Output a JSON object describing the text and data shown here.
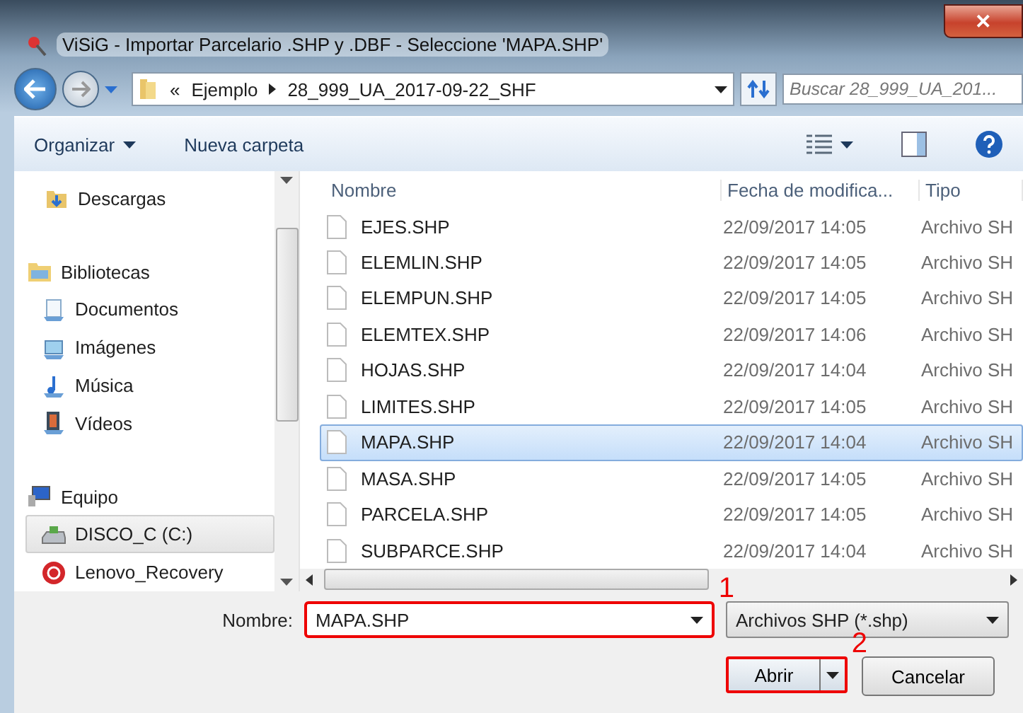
{
  "window": {
    "title": "ViSiG - Importar Parcelario .SHP y .DBF - Seleccione 'MAPA.SHP'",
    "close": "✕"
  },
  "address": {
    "overflow": "«",
    "crumbs": [
      "Ejemplo",
      "28_999_UA_2017-09-22_SHF"
    ]
  },
  "search": {
    "placeholder": "Buscar 28_999_UA_201..."
  },
  "toolbar": {
    "organize": "Organizar",
    "new_folder": "Nueva carpeta"
  },
  "sidebar": {
    "items": [
      {
        "label": "Descargas",
        "kind": "downloads",
        "selected": false
      },
      {
        "label": "Bibliotecas",
        "kind": "library",
        "selected": false,
        "children": [
          {
            "label": "Documentos",
            "kind": "documents",
            "selected": false
          },
          {
            "label": "Imágenes",
            "kind": "images",
            "selected": false
          },
          {
            "label": "Música",
            "kind": "music",
            "selected": false
          },
          {
            "label": "Vídeos",
            "kind": "videos",
            "selected": false
          }
        ]
      },
      {
        "label": "Equipo",
        "kind": "computer",
        "selected": false,
        "children": [
          {
            "label": "DISCO_C (C:)",
            "kind": "drive",
            "selected": true
          },
          {
            "label": "Lenovo_Recovery",
            "kind": "recovery",
            "selected": false
          }
        ]
      }
    ]
  },
  "table": {
    "columns": [
      "Nombre",
      "Fecha de modifica...",
      "Tipo"
    ],
    "rows": [
      {
        "name": "EJES.SHP",
        "date": "22/09/2017 14:05",
        "type": "Archivo SH",
        "selected": false
      },
      {
        "name": "ELEMLIN.SHP",
        "date": "22/09/2017 14:05",
        "type": "Archivo SH",
        "selected": false
      },
      {
        "name": "ELEMPUN.SHP",
        "date": "22/09/2017 14:05",
        "type": "Archivo SH",
        "selected": false
      },
      {
        "name": "ELEMTEX.SHP",
        "date": "22/09/2017 14:06",
        "type": "Archivo SH",
        "selected": false
      },
      {
        "name": "HOJAS.SHP",
        "date": "22/09/2017 14:04",
        "type": "Archivo SH",
        "selected": false
      },
      {
        "name": "LIMITES.SHP",
        "date": "22/09/2017 14:05",
        "type": "Archivo SH",
        "selected": false
      },
      {
        "name": "MAPA.SHP",
        "date": "22/09/2017 14:04",
        "type": "Archivo SH",
        "selected": true
      },
      {
        "name": "MASA.SHP",
        "date": "22/09/2017 14:05",
        "type": "Archivo SH",
        "selected": false
      },
      {
        "name": "PARCELA.SHP",
        "date": "22/09/2017 14:05",
        "type": "Archivo SH",
        "selected": false
      },
      {
        "name": "SUBPARCE.SHP",
        "date": "22/09/2017 14:04",
        "type": "Archivo SH",
        "selected": false
      }
    ]
  },
  "footer": {
    "name_label": "Nombre:",
    "name_value": "MAPA.SHP",
    "name_highlighted": true,
    "name_annotation": "1",
    "filter": "Archivos SHP (*.shp)",
    "open": "Abrir",
    "open_highlighted": true,
    "open_annotation": "2",
    "cancel": "Cancelar"
  }
}
